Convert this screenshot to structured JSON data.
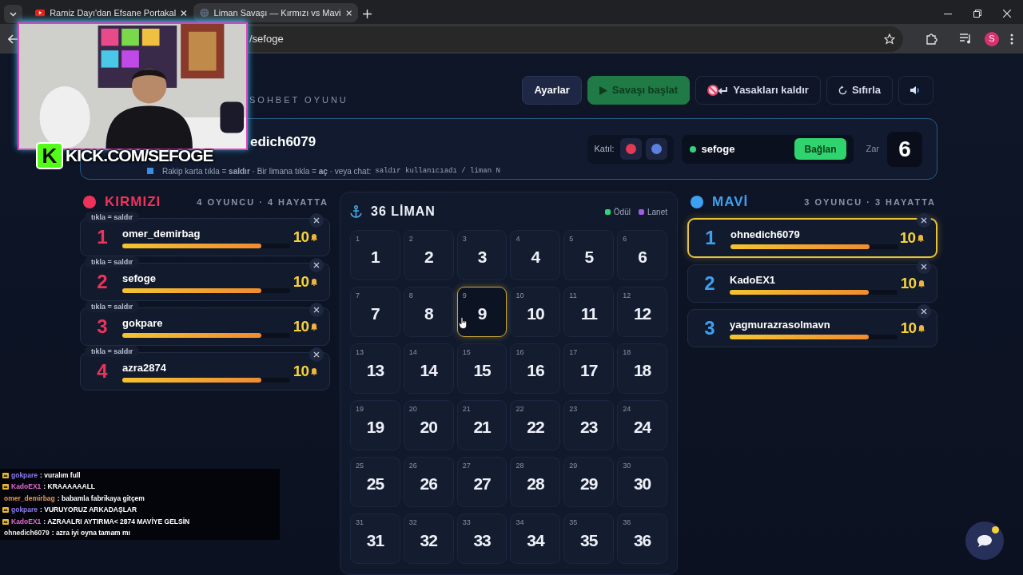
{
  "browser": {
    "tabs": [
      {
        "title": "Ramiz Dayı'dan Efsane Portakal",
        "kind": "video",
        "selected": false
      },
      {
        "title": "Liman Savaşı — Kırmızı vs Mavi",
        "kind": "web",
        "selected": true
      }
    ],
    "address": "/sefoge",
    "profile": "S"
  },
  "stream_overlay": {
    "kind": "picture",
    "logo_letter": "K",
    "caption": "KICK.COM/SEFOGE"
  },
  "subtitle": "SOHBET OYUNU",
  "toolbar": [
    {
      "kind": "settings",
      "label": "Ayarlar"
    },
    {
      "kind": "start",
      "label": "Savaşı başlat"
    },
    {
      "kind": "unban",
      "label": "Yasakları kaldır"
    },
    {
      "kind": "reset",
      "label": "Sıfırla"
    },
    {
      "kind": "sound"
    }
  ],
  "banner": {
    "player": "edich6079",
    "hint": "Rakip karta tıkla = **saldır** · Bir limana tıkla = **aç** · veya chat:",
    "command": "saldır kullanıcıadı / liman N",
    "join_label": "Katıl:",
    "join_teams": [
      {
        "color": "#e23a55"
      },
      {
        "color": "#5a82dc"
      }
    ],
    "connected": true,
    "channel": "sefoge",
    "connect_button": "Bağlan",
    "dice_label": "Zar",
    "dice": "6"
  },
  "teams": [
    {
      "name": "KIRMIZI",
      "color": "#f0325a",
      "summary": "4 OYUNCU · 4 HAYATTA",
      "players": [
        {
          "rank": "1",
          "name": "omer_demirbag",
          "tag": "tıkla = saldır",
          "lives": "10",
          "level": 0.83,
          "selected": false
        },
        {
          "rank": "2",
          "name": "sefoge",
          "tag": "tıkla = saldır",
          "lives": "10",
          "level": 0.83,
          "selected": false
        },
        {
          "rank": "3",
          "name": "gokpare",
          "tag": "tıkla = saldır",
          "lives": "10",
          "level": 0.83,
          "selected": false
        },
        {
          "rank": "4",
          "name": "azra2874",
          "tag": "tıkla = saldır",
          "lives": "10",
          "level": 0.83,
          "selected": false
        }
      ]
    },
    {
      "name": "MAVİ",
      "color": "#3ea0f0",
      "summary": "3 OYUNCU · 3 HAYATTA",
      "players": [
        {
          "rank": "1",
          "name": "ohnedich6079",
          "lives": "10",
          "level": 0.83,
          "selected": true
        },
        {
          "rank": "2",
          "name": "KadoEX1",
          "lives": "10",
          "level": 0.83,
          "selected": false
        },
        {
          "rank": "3",
          "name": "yagmurazrasolmavn",
          "lives": "10",
          "level": 0.83,
          "selected": false
        }
      ]
    }
  ],
  "board": {
    "title": "36 LİMAN",
    "legend": [
      {
        "label": "Ödül",
        "color": "#34d27a"
      },
      {
        "label": "Lanet",
        "color": "#a05be0"
      }
    ],
    "ports": [
      {
        "index": "1",
        "label": "1",
        "selected": false
      },
      {
        "index": "2",
        "label": "2",
        "selected": false
      },
      {
        "index": "3",
        "label": "3",
        "selected": false
      },
      {
        "index": "4",
        "label": "4",
        "selected": false
      },
      {
        "index": "5",
        "label": "5",
        "selected": false
      },
      {
        "index": "6",
        "label": "6",
        "selected": false
      },
      {
        "index": "7",
        "label": "7",
        "selected": false
      },
      {
        "index": "8",
        "label": "8",
        "selected": false
      },
      {
        "index": "9",
        "label": "9",
        "selected": true
      },
      {
        "index": "10",
        "label": "10",
        "selected": false
      },
      {
        "index": "11",
        "label": "11",
        "selected": false
      },
      {
        "index": "12",
        "label": "12",
        "selected": false
      },
      {
        "index": "13",
        "label": "13",
        "selected": false
      },
      {
        "index": "14",
        "label": "14",
        "selected": false
      },
      {
        "index": "15",
        "label": "15",
        "selected": false
      },
      {
        "index": "16",
        "label": "16",
        "selected": false
      },
      {
        "index": "17",
        "label": "17",
        "selected": false
      },
      {
        "index": "18",
        "label": "18",
        "selected": false
      },
      {
        "index": "19",
        "label": "19",
        "selected": false
      },
      {
        "index": "20",
        "label": "20",
        "selected": false
      },
      {
        "index": "21",
        "label": "21",
        "selected": false
      },
      {
        "index": "22",
        "label": "22",
        "selected": false
      },
      {
        "index": "23",
        "label": "23",
        "selected": false
      },
      {
        "index": "24",
        "label": "24",
        "selected": false
      },
      {
        "index": "25",
        "label": "25",
        "selected": false
      },
      {
        "index": "26",
        "label": "26",
        "selected": false
      },
      {
        "index": "27",
        "label": "27",
        "selected": false
      },
      {
        "index": "28",
        "label": "28",
        "selected": false
      },
      {
        "index": "29",
        "label": "29",
        "selected": false
      },
      {
        "index": "30",
        "label": "30",
        "selected": false
      },
      {
        "index": "31",
        "label": "31",
        "selected": false
      },
      {
        "index": "32",
        "label": "32",
        "selected": false
      },
      {
        "index": "33",
        "label": "33",
        "selected": false
      },
      {
        "index": "34",
        "label": "34",
        "selected": false
      },
      {
        "index": "35",
        "label": "35",
        "selected": false
      },
      {
        "index": "36",
        "label": "36",
        "selected": false
      }
    ]
  },
  "chat": [
    {
      "user": "gokpare",
      "message": ": vuralım full",
      "badge": true,
      "color": "#8c7cf0"
    },
    {
      "user": "KadoEX1",
      "message": ": KRAAAAAALL",
      "badge": true,
      "color": "#e06ad0"
    },
    {
      "user": "omer_demirbag",
      "message": ": babamla fabrikaya gitçem",
      "badge": false,
      "color": "#e0965a"
    },
    {
      "user": "gokpare",
      "message": ": VURUYORUZ ARKADAŞLAR",
      "badge": true,
      "color": "#8c7cf0"
    },
    {
      "user": "KadoEX1",
      "message": ": AZRAALRI AYTIRMA< 2874 MAVİYE GELSİN",
      "badge": true,
      "color": "#e06ad0"
    },
    {
      "user": "ohnedich6079",
      "message": ": azra iyi oyna tamam mı",
      "badge": false,
      "color": "#e6e6e6"
    }
  ],
  "chat_button": {
    "unread": true
  }
}
